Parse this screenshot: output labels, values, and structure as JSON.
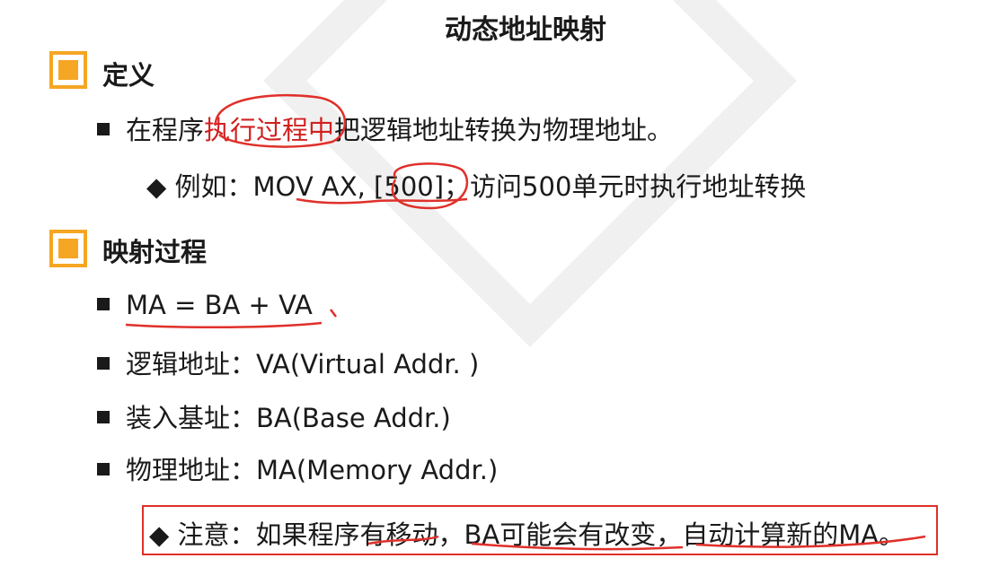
{
  "title": "动态地址映射",
  "sections": [
    {
      "heading": "定义"
    },
    {
      "heading": "映射过程"
    }
  ],
  "definition": {
    "b1_pre": "在程序",
    "b1_red": "执行过程中",
    "b1_post": "把逻辑地址转换为物理地址。",
    "example": "◆ 例如：MOV AX, [500]；访问500单元时执行地址转换"
  },
  "mapping": {
    "formula": "MA = BA + VA",
    "va": "逻辑地址：VA(Virtual Addr. )",
    "ba": "装入基址：BA(Base Addr.)",
    "ma": "物理地址：MA(Memory Addr.)"
  },
  "note": "◆ 注意：如果程序有移动，BA可能会有改变，自动计算新的MA。",
  "colors": {
    "accent": "#f5a623",
    "highlight": "#d02020",
    "annotation": "#e0302a"
  }
}
